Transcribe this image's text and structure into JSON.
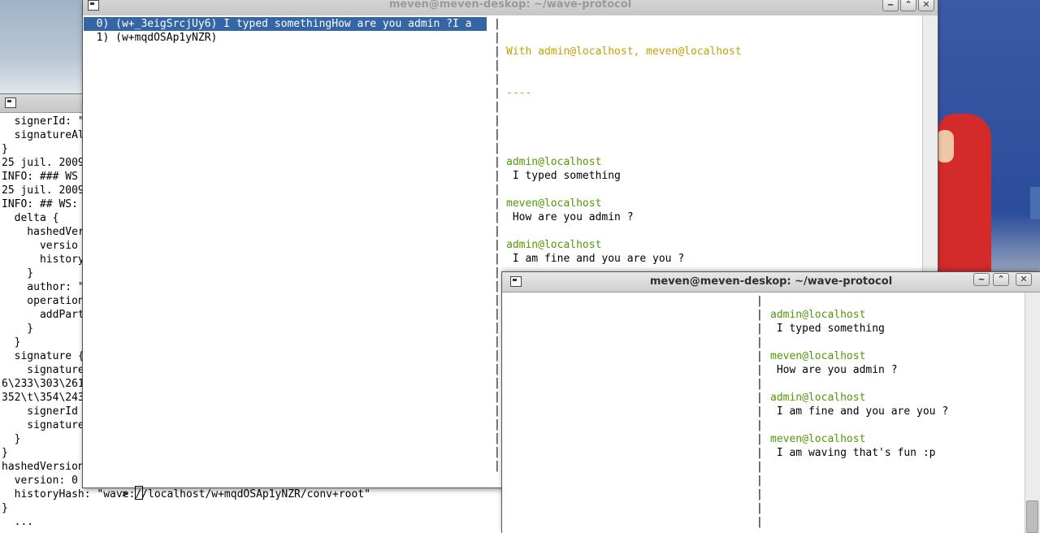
{
  "window_a": {
    "lines": [
      "  signerId: \"",
      "  signatureAl",
      "}",
      "",
      "25 juil. 2009",
      "INFO: ### WS",
      "25 juil. 2009",
      "INFO: ## WS:",
      "  delta {",
      "    hashedVer",
      "      versio",
      "      history",
      "    }",
      "    author: \"",
      "    operation",
      "      addPart",
      "    }",
      "  }",
      "  signature {",
      "    signature",
      "6\\233\\303\\261",
      "352\\t\\354\\243",
      "    signerId",
      "    signature",
      "  }",
      "}",
      "hashedVersion",
      "  version: 0",
      "  historyHash: \"wave://localhost/w+mqdOSAp1yNZR/conv+root\"",
      "}",
      "  ..."
    ]
  },
  "window_b": {
    "title": "meven@meven-deskop: ~/wave-protocol",
    "wave_list": [
      {
        "label": "  0) (w+_3eigSrcjUy6) I typed somethingHow are you admin ?I a",
        "selected": true
      },
      {
        "label": "  1) (w+mqdOSAp1yNZR)",
        "selected": false
      }
    ],
    "header": "With admin@localhost, meven@localhost",
    "separator": "----",
    "messages": [
      {
        "author": "admin@localhost",
        "text": " I typed something"
      },
      {
        "author": "meven@localhost",
        "text": " How are you admin ?"
      },
      {
        "author": "admin@localhost",
        "text": " I am fine and you are you ?"
      },
      {
        "author": "meven@localhost",
        "text": " I am waving that's fun :p"
      }
    ],
    "prompt": ">"
  },
  "window_c": {
    "title": "meven@meven-deskop: ~/wave-protocol",
    "messages": [
      {
        "author": "admin@localhost",
        "text": " I typed something"
      },
      {
        "author": "meven@localhost",
        "text": " How are you admin ?"
      },
      {
        "author": "admin@localhost",
        "text": " I am fine and you are you ?"
      },
      {
        "author": "meven@localhost",
        "text": " I am waving that's fun :p"
      }
    ]
  },
  "window_buttons": {
    "minimize": "‒",
    "maximize": "⌃",
    "close": "✕"
  },
  "colors": {
    "author": "#4e9a06",
    "header": "#c4a000",
    "selection": "#3465a4"
  }
}
